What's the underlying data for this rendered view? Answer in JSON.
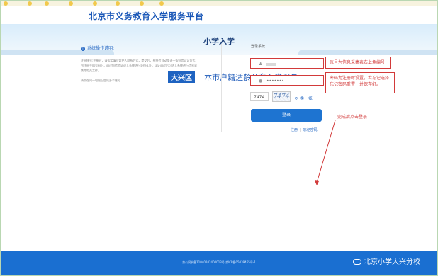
{
  "header": {
    "site_title": "北京市义务教育入学服务平台"
  },
  "banner": {
    "title": "小学入学"
  },
  "district": {
    "badge": "大兴区",
    "service": "本市户籍适龄儿童入学服务"
  },
  "notice": {
    "heading": "系统操作说明:",
    "body": "注册帐号:注册时，请如实填写监护人联系方式，提交后，系统会自动发送一条短信认证方式到注册手机号码上，通过短信验证进入系统进行身份认证，认证通过后可进入系统进行信息采集等相关工作。",
    "footer": "请勿在同一电脑上登陆多个账号"
  },
  "login": {
    "title": "登录系统",
    "password_mask": "•••••••",
    "captcha_value": "7474",
    "captcha_image_text": "7474",
    "refresh_label": "换一张",
    "button_label": "登录",
    "register_link": "注册",
    "forgot_link": "忘记密码"
  },
  "annotations": {
    "account_note": "账号为信息采集表右上角编号",
    "password_note": "密码为注册时设置，若忘记选择忘记密码重置，并保存好。",
    "login_note": "完成后点击登录"
  },
  "footer": {
    "text": "京公网安备11040202400013号 京ICP备05039465号-1",
    "watermark": "北京小学大兴分校"
  },
  "colors": {
    "accent": "#1e63c1",
    "annotation": "#d23a3a",
    "footer": "#1a6fd1"
  }
}
